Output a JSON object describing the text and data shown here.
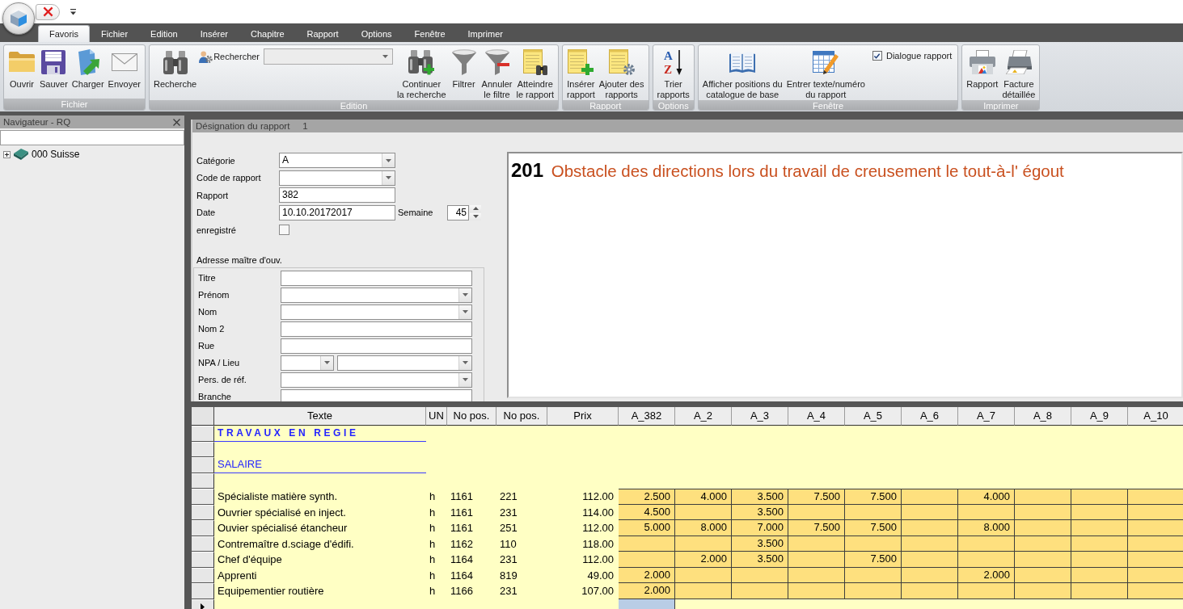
{
  "ribbon": {
    "tabs": [
      {
        "label": "Favoris",
        "selected": true
      },
      {
        "label": "Fichier",
        "selected": false
      },
      {
        "label": "Edition",
        "selected": false
      },
      {
        "label": "Insérer",
        "selected": false
      },
      {
        "label": "Chapitre",
        "selected": false
      },
      {
        "label": "Rapport",
        "selected": false
      },
      {
        "label": "Options",
        "selected": false
      },
      {
        "label": "Fenêtre",
        "selected": false
      },
      {
        "label": "Imprimer",
        "selected": false
      }
    ],
    "groups": [
      {
        "label": "Fichier",
        "items": [
          {
            "kind": "large",
            "lines": [
              "Ouvrir"
            ]
          },
          {
            "kind": "large",
            "lines": [
              "Sauver"
            ]
          },
          {
            "kind": "large",
            "lines": [
              "Charger"
            ]
          },
          {
            "kind": "large",
            "lines": [
              "Envoyer"
            ]
          }
        ]
      },
      {
        "label": "Edition",
        "items": [
          {
            "kind": "large",
            "lines": [
              "Recherche"
            ]
          },
          {
            "kind": "search",
            "label": "Rechercher"
          },
          {
            "kind": "large",
            "lines": [
              "Continuer",
              "la recherche"
            ]
          },
          {
            "kind": "large",
            "lines": [
              "Filtrer"
            ]
          },
          {
            "kind": "large",
            "lines": [
              "Annuler",
              "le filtre"
            ]
          },
          {
            "kind": "large",
            "lines": [
              "Atteindre",
              "le rapport"
            ]
          }
        ]
      },
      {
        "label": "Rapport",
        "items": [
          {
            "kind": "large",
            "lines": [
              "Insérer",
              "rapport"
            ]
          },
          {
            "kind": "large",
            "lines": [
              "Ajouter des",
              "rapports"
            ]
          }
        ]
      },
      {
        "label": "Options",
        "items": [
          {
            "kind": "large",
            "lines": [
              "Trier",
              "rapports"
            ],
            "glyphs": [
              "A",
              "Z"
            ]
          }
        ]
      },
      {
        "label": "Fenêtre",
        "items": [
          {
            "kind": "large",
            "lines": [
              "Afficher positions du",
              "catalogue de base"
            ]
          },
          {
            "kind": "large",
            "lines": [
              "Entrer texte/numéro",
              "du rapport"
            ]
          },
          {
            "kind": "checkbox",
            "label": "Dialogue rapport",
            "checked": true
          }
        ]
      },
      {
        "label": "Imprimer",
        "items": [
          {
            "kind": "large",
            "lines": [
              "Rapport"
            ]
          },
          {
            "kind": "large",
            "lines": [
              "Facture",
              "détaillée"
            ]
          }
        ]
      }
    ]
  },
  "navigator": {
    "title": "Navigateur - RQ",
    "tree": [
      {
        "label": "000 Suisse",
        "expanded": false
      }
    ]
  },
  "report": {
    "title": "Désignation du rapport",
    "number": "1",
    "fields": [
      {
        "kind": "combo",
        "label": "Catégorie",
        "value": "A"
      },
      {
        "kind": "combo",
        "label": "Code de rapport"
      },
      {
        "kind": "text",
        "label": "Rapport",
        "value": "382"
      },
      {
        "kind": "text",
        "label": "Date",
        "value": "10.10.20172017",
        "week": {
          "label": "Semaine",
          "value": "45"
        }
      },
      {
        "kind": "checkbox",
        "label": "enregistré",
        "checked": false
      }
    ],
    "address": {
      "title": "Adresse maître d'ouv.",
      "fields": [
        {
          "kind": "text",
          "label": "Titre"
        },
        {
          "kind": "combo",
          "label": "Prénom"
        },
        {
          "kind": "combo",
          "label": "Nom"
        },
        {
          "kind": "text",
          "label": "Nom 2"
        },
        {
          "kind": "text",
          "label": "Rue"
        },
        {
          "kind": "combo_pair",
          "label": "NPA / Lieu"
        },
        {
          "kind": "combo",
          "label": "Pers. de réf."
        },
        {
          "kind": "text",
          "label": "Branche"
        }
      ]
    },
    "description": {
      "number": "201",
      "text": "Obstacle des directions lors du travail de creusement le tout-à-l' égout"
    }
  },
  "grid": {
    "columns": [
      "Texte",
      "UN",
      "No pos.",
      "No pos.",
      "Prix",
      "A_382",
      "A_2",
      "A_3",
      "A_4",
      "A_5",
      "A_6",
      "A_7",
      "A_8",
      "A_9",
      "A_10"
    ],
    "rows": [
      {
        "kind": "title",
        "text": "TRAVAUX EN REGIE"
      },
      {
        "kind": "blank"
      },
      {
        "kind": "subtitle",
        "text": "SALAIRE"
      },
      {
        "kind": "blank"
      },
      {
        "kind": "item",
        "text": "Spécialiste matière synth.",
        "unit": "h",
        "pos_1": "1161",
        "pos_2": "221",
        "price": "112.00",
        "cells": [
          {
            "kind": "value",
            "text": "2.500"
          },
          {
            "kind": "value",
            "text": "4.000"
          },
          {
            "kind": "value",
            "text": "3.500"
          },
          {
            "kind": "value",
            "text": "7.500"
          },
          {
            "kind": "value",
            "text": "7.500"
          },
          {
            "kind": "empty"
          },
          {
            "kind": "value",
            "text": "4.000"
          },
          {
            "kind": "empty"
          },
          {
            "kind": "empty"
          },
          {
            "kind": "empty"
          }
        ]
      },
      {
        "kind": "item",
        "text": "Ouvrier spécialisé en inject.",
        "unit": "h",
        "pos_1": "1161",
        "pos_2": "231",
        "price": "114.00",
        "cells": [
          {
            "kind": "value",
            "text": "4.500"
          },
          {
            "kind": "empty"
          },
          {
            "kind": "value",
            "text": "3.500"
          },
          {
            "kind": "empty"
          },
          {
            "kind": "empty"
          },
          {
            "kind": "empty"
          },
          {
            "kind": "empty"
          },
          {
            "kind": "empty"
          },
          {
            "kind": "empty"
          },
          {
            "kind": "empty"
          }
        ]
      },
      {
        "kind": "item",
        "text": "Ouvier spécialisé étancheur",
        "unit": "h",
        "pos_1": "1161",
        "pos_2": "251",
        "price": "112.00",
        "cells": [
          {
            "kind": "value",
            "text": "5.000"
          },
          {
            "kind": "value",
            "text": "8.000"
          },
          {
            "kind": "value",
            "text": "7.000"
          },
          {
            "kind": "value",
            "text": "7.500"
          },
          {
            "kind": "value",
            "text": "7.500"
          },
          {
            "kind": "empty"
          },
          {
            "kind": "value",
            "text": "8.000"
          },
          {
            "kind": "empty"
          },
          {
            "kind": "empty"
          },
          {
            "kind": "empty"
          }
        ]
      },
      {
        "kind": "item",
        "text": "Contremaître d.sciage d'édifi.",
        "unit": "h",
        "pos_1": "1162",
        "pos_2": "110",
        "price": "118.00",
        "cells": [
          {
            "kind": "empty"
          },
          {
            "kind": "empty"
          },
          {
            "kind": "value",
            "text": "3.500"
          },
          {
            "kind": "empty"
          },
          {
            "kind": "empty"
          },
          {
            "kind": "empty"
          },
          {
            "kind": "empty"
          },
          {
            "kind": "empty"
          },
          {
            "kind": "empty"
          },
          {
            "kind": "empty"
          }
        ]
      },
      {
        "kind": "item",
        "text": "Chef d'équipe",
        "unit": "h",
        "pos_1": "1164",
        "pos_2": "231",
        "price": "112.00",
        "cells": [
          {
            "kind": "empty"
          },
          {
            "kind": "value",
            "text": "2.000"
          },
          {
            "kind": "value",
            "text": "3.500"
          },
          {
            "kind": "empty"
          },
          {
            "kind": "value",
            "text": "7.500"
          },
          {
            "kind": "empty"
          },
          {
            "kind": "empty"
          },
          {
            "kind": "empty"
          },
          {
            "kind": "empty"
          },
          {
            "kind": "empty"
          }
        ]
      },
      {
        "kind": "item",
        "text": "Apprenti",
        "unit": "h",
        "pos_1": "1164",
        "pos_2": "819",
        "price": "49.00",
        "cells": [
          {
            "kind": "value",
            "text": "2.000"
          },
          {
            "kind": "empty"
          },
          {
            "kind": "empty"
          },
          {
            "kind": "empty"
          },
          {
            "kind": "empty"
          },
          {
            "kind": "empty"
          },
          {
            "kind": "value",
            "text": "2.000"
          },
          {
            "kind": "empty"
          },
          {
            "kind": "empty"
          },
          {
            "kind": "empty"
          }
        ]
      },
      {
        "kind": "item",
        "text": "Equipementier routière",
        "unit": "h",
        "pos_1": "1166",
        "pos_2": "231",
        "price": "107.00",
        "cells": [
          {
            "kind": "value",
            "text": "2.000"
          },
          {
            "kind": "empty"
          },
          {
            "kind": "empty"
          },
          {
            "kind": "empty"
          },
          {
            "kind": "empty"
          },
          {
            "kind": "empty"
          },
          {
            "kind": "empty"
          },
          {
            "kind": "empty"
          },
          {
            "kind": "empty"
          },
          {
            "kind": "empty"
          }
        ]
      },
      {
        "kind": "new",
        "current": true
      }
    ]
  }
}
